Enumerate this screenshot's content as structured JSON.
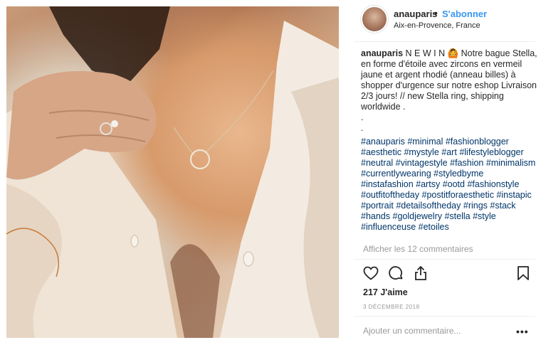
{
  "post": {
    "username": "anauparis",
    "separator": "•",
    "follow_label": "S'abonner",
    "location": "Aix-en-Provence, France",
    "caption_text": "N E W I N 🙆 Notre bague Stella, en forme d'étoile avec zircons en vermeil jaune et argent rhodié (anneau billes) à shopper d'urgence sur notre eshop Livraison 2/3 jours! // new Stella ring, shipping worldwide .",
    "caption_dot1": ".",
    "caption_dot2": ".",
    "hashtags": [
      "#anauparis",
      "#minimal",
      "#fashionblogger",
      "#aesthetic",
      "#mystyle",
      "#art",
      "#lifestyleblogger",
      "#neutral",
      "#vintagestyle",
      "#fashion",
      "#minimalism",
      "#currentlywearing",
      "#styledbyme",
      "#instafashion",
      "#artsy",
      "#ootd",
      "#fashionstyle",
      "#outfitoftheday",
      "#postitforaesthetic",
      "#instapic",
      "#portrait",
      "#detailsoftheday",
      "#rings",
      "#stack",
      "#hands",
      "#goldjewelry",
      "#stella",
      "#style",
      "#influenceuse",
      "#etoiles"
    ],
    "view_comments_label": "Afficher les 12 commentaires",
    "likes": "217 J'aime",
    "date": "3 DÉCEMBRE 2018",
    "comment_placeholder": "Ajouter un commentaire...",
    "more_label": "•••"
  },
  "icons": {
    "like": "heart-icon",
    "comment": "comment-icon",
    "share": "share-icon",
    "save": "bookmark-icon"
  },
  "colors": {
    "link_blue": "#3897f0",
    "hashtag": "#003569",
    "muted": "#999999",
    "text": "#262626"
  }
}
